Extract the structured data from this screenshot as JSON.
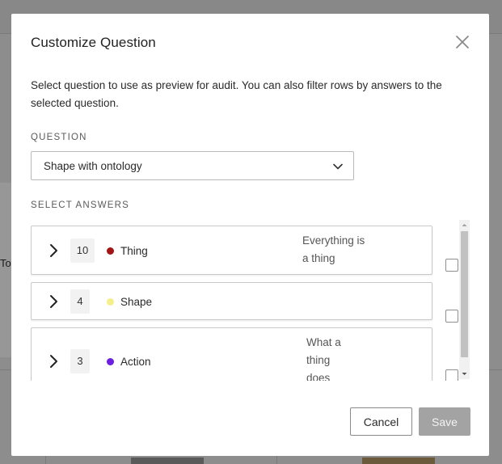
{
  "background": {
    "partial_text": "To"
  },
  "modal": {
    "title": "Customize Question",
    "description": "Select question to use as preview for audit. You can also filter rows by answers to the selected question.",
    "question_label": "QUESTION",
    "question_value": "Shape with ontology",
    "answers_label": "SELECT ANSWERS",
    "answers": [
      {
        "count": "10",
        "label": "Thing",
        "color": "#a31515",
        "description": "Everything is a thing",
        "checked": false
      },
      {
        "count": "4",
        "label": "Shape",
        "color": "#f5ef8a",
        "description": "",
        "checked": false
      },
      {
        "count": "3",
        "label": "Action",
        "color": "#6d1fe0",
        "description": "What a thing does",
        "checked": false
      }
    ],
    "cancel_label": "Cancel",
    "save_label": "Save"
  },
  "icons": {
    "close": "close-icon",
    "dropdown": "chevron-down-icon",
    "expand": "chevron-right-icon"
  }
}
